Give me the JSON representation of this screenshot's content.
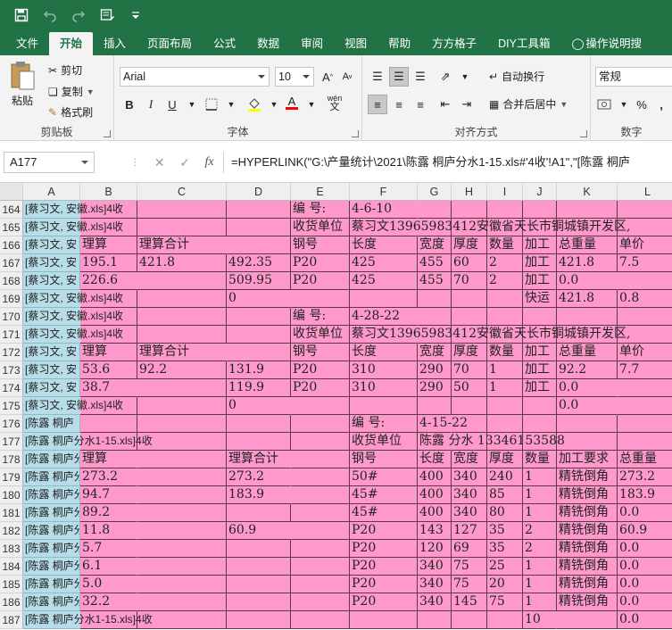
{
  "quick_access": {
    "save": "save-icon",
    "undo": "undo-icon",
    "redo": "redo-icon",
    "form": "form-icon",
    "customize": "customize-icon"
  },
  "tabs": [
    "文件",
    "开始",
    "插入",
    "页面布局",
    "公式",
    "数据",
    "审阅",
    "视图",
    "帮助",
    "方方格子",
    "DIY工具箱",
    "操作说明搜"
  ],
  "active_tab": "开始",
  "ribbon": {
    "clipboard": {
      "paste": "粘贴",
      "cut": "剪切",
      "copy": "复制",
      "format_painter": "格式刷",
      "label": "剪贴板"
    },
    "font": {
      "name": "Arial",
      "size": "10",
      "bold": "B",
      "italic": "I",
      "underline": "U",
      "font_color_glyph": "A",
      "phonetic": "wén",
      "label": "字体"
    },
    "alignment": {
      "wrap": "自动换行",
      "merge": "合并后居中",
      "label": "对齐方式"
    },
    "number": {
      "format": "常规",
      "percent": "%",
      "comma": ",",
      "label": "数字"
    }
  },
  "formula_bar": {
    "name_box": "A177",
    "fx": "fx",
    "formula": "=HYPERLINK(\"G:\\产量统计\\2021\\陈露  桐庐分水1-15.xls#'4收'!A1\",\"[陈露  桐庐"
  },
  "columns": [
    "A",
    "B",
    "C",
    "D",
    "E",
    "F",
    "G",
    "H",
    "I",
    "J",
    "K",
    "L"
  ],
  "rows": [
    {
      "num": "164",
      "cells": [
        "[蔡习文, 安徽.xls]4收",
        "",
        "",
        "",
        "编   号:",
        "4-6-10",
        "",
        "",
        "",
        "",
        "",
        ""
      ]
    },
    {
      "num": "165",
      "cells": [
        "[蔡习文, 安徽.xls]4收",
        "",
        "",
        "",
        "收货单位",
        "蔡习文13965983412安徽省天长市铜城镇开发区,",
        "",
        "",
        "",
        "",
        "",
        ""
      ]
    },
    {
      "num": "166",
      "cells": [
        "[蔡习文, 安",
        "理算",
        "理算合计",
        "",
        "钢号",
        "长度",
        "宽度",
        "厚度",
        "数量",
        "加工",
        "总重量",
        "单价"
      ]
    },
    {
      "num": "167",
      "cells": [
        "[蔡习文, 安",
        "195.1",
        "421.8",
        "492.35",
        "P20",
        "425",
        "455",
        "60",
        "2",
        "加工",
        "421.8",
        "7.5"
      ]
    },
    {
      "num": "168",
      "cells": [
        "[蔡习文, 安",
        "226.6",
        "",
        "509.95",
        "P20",
        "425",
        "455",
        "70",
        "2",
        "加工",
        "0.0",
        ""
      ]
    },
    {
      "num": "169",
      "cells": [
        "[蔡习文, 安徽.xls]4收",
        "",
        "",
        "0",
        "",
        "",
        "",
        "",
        "",
        "快运",
        "421.8",
        "0.8"
      ]
    },
    {
      "num": "170",
      "cells": [
        "[蔡习文, 安徽.xls]4收",
        "",
        "",
        "",
        "编   号:",
        "4-28-22",
        "",
        "",
        "",
        "",
        "",
        ""
      ]
    },
    {
      "num": "171",
      "cells": [
        "[蔡习文, 安徽.xls]4收",
        "",
        "",
        "",
        "收货单位",
        "蔡习文13965983412安徽省天长市铜城镇开发区,",
        "",
        "",
        "",
        "",
        "",
        ""
      ]
    },
    {
      "num": "172",
      "cells": [
        "[蔡习文, 安",
        "理算",
        "理算合计",
        "",
        "钢号",
        "长度",
        "宽度",
        "厚度",
        "数量",
        "加工",
        "总重量",
        "单价"
      ]
    },
    {
      "num": "173",
      "cells": [
        "[蔡习文, 安",
        "53.6",
        "92.2",
        "131.9",
        "P20",
        "310",
        "290",
        "70",
        "1",
        "加工",
        "92.2",
        "7.7"
      ]
    },
    {
      "num": "174",
      "cells": [
        "[蔡习文, 安",
        "38.7",
        "",
        "119.9",
        "P20",
        "310",
        "290",
        "50",
        "1",
        "加工",
        "0.0",
        ""
      ]
    },
    {
      "num": "175",
      "cells": [
        "[蔡习文, 安徽.xls]4收",
        "",
        "",
        "0",
        "",
        "",
        "",
        "",
        "",
        "",
        "0.0",
        ""
      ]
    },
    {
      "num": "176",
      "cells": [
        "[陈露  桐庐",
        "",
        "",
        "",
        "",
        "编   号:",
        "4-15-22",
        "",
        "",
        "",
        "",
        ""
      ]
    },
    {
      "num": "177",
      "cells": [
        "[陈露  桐庐分水1-15.xls]4收",
        "",
        "",
        "",
        "",
        "收货单位",
        "陈露  分水  13346153588",
        "",
        "",
        "",
        "",
        ""
      ]
    },
    {
      "num": "178",
      "cells": [
        "[陈露  桐庐分水1-15.x",
        "理算",
        "",
        "理算合计",
        "",
        "钢号",
        "长度",
        "宽度",
        "厚度",
        "数量",
        "加工要求",
        "总重量"
      ]
    },
    {
      "num": "179",
      "cells": [
        "[陈露  桐庐分水1-15.x",
        "273.2",
        "",
        "273.2",
        "",
        "50#",
        "400",
        "340",
        "240",
        "1",
        "精铣倒角",
        "273.2"
      ]
    },
    {
      "num": "180",
      "cells": [
        "[陈露  桐庐分水1-15.x",
        "94.7",
        "",
        "183.9",
        "",
        "45#",
        "400",
        "340",
        "85",
        "1",
        "精铣倒角",
        "183.9"
      ]
    },
    {
      "num": "181",
      "cells": [
        "[陈露  桐庐分水1-15.x",
        "89.2",
        "",
        "",
        "",
        "45#",
        "400",
        "340",
        "80",
        "1",
        "精铣倒角",
        "0.0"
      ]
    },
    {
      "num": "182",
      "cells": [
        "[陈露  桐庐分水1-15.x",
        "11.8",
        "",
        "60.9",
        "",
        "P20",
        "143",
        "127",
        "35",
        "2",
        "精铣倒角",
        "60.9"
      ]
    },
    {
      "num": "183",
      "cells": [
        "[陈露  桐庐分水1-15.x",
        "5.7",
        "",
        "",
        "",
        "P20",
        "120",
        "69",
        "35",
        "2",
        "精铣倒角",
        "0.0"
      ]
    },
    {
      "num": "184",
      "cells": [
        "[陈露  桐庐分水1-15.x",
        "6.1",
        "",
        "",
        "",
        "P20",
        "340",
        "75",
        "25",
        "1",
        "精铣倒角",
        "0.0"
      ]
    },
    {
      "num": "185",
      "cells": [
        "[陈露  桐庐分水1-15.x",
        "5.0",
        "",
        "",
        "",
        "P20",
        "340",
        "75",
        "20",
        "1",
        "精铣倒角",
        "0.0"
      ]
    },
    {
      "num": "186",
      "cells": [
        "[陈露  桐庐分水1-15.x",
        "32.2",
        "",
        "",
        "",
        "P20",
        "340",
        "145",
        "75",
        "1",
        "精铣倒角",
        "0.0"
      ]
    },
    {
      "num": "187",
      "cells": [
        "[陈露  桐庐分水1-15.xls]4收",
        "",
        "",
        "",
        "",
        "",
        "",
        "",
        "",
        "10",
        "",
        "0.0"
      ]
    }
  ]
}
